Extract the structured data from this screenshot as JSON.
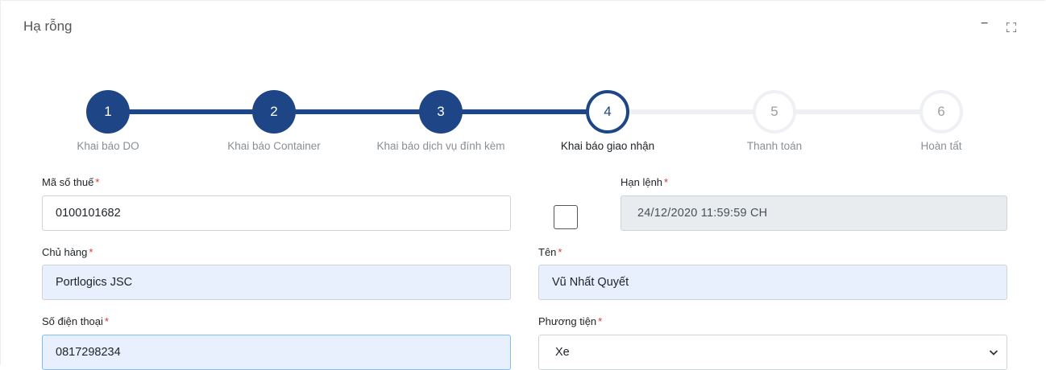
{
  "window": {
    "title": "Hạ rỗng",
    "minimize_label": "−"
  },
  "steps": [
    {
      "number": "1",
      "label": "Khai báo DO",
      "state": "done"
    },
    {
      "number": "2",
      "label": "Khai báo Container",
      "state": "done"
    },
    {
      "number": "3",
      "label": "Khai báo dịch vụ đính kèm",
      "state": "done"
    },
    {
      "number": "4",
      "label": "Khai báo giao nhận",
      "state": "current"
    },
    {
      "number": "5",
      "label": "Thanh toán",
      "state": "todo"
    },
    {
      "number": "6",
      "label": "Hoàn tất",
      "state": "todo"
    }
  ],
  "form": {
    "tax_code": {
      "label": "Mã số thuế",
      "required_mark": "*",
      "value": "0100101682"
    },
    "deadline": {
      "label": "Hạn lệnh",
      "required_mark": "*",
      "value": "24/12/2020 11:59:59 CH"
    },
    "owner": {
      "label": "Chủ hàng",
      "required_mark": "*",
      "value": "Portlogics JSC"
    },
    "name": {
      "label": "Tên",
      "required_mark": "*",
      "value": "Vũ Nhất Quyết"
    },
    "phone": {
      "label": "Số điện thoại",
      "required_mark": "*",
      "value": "0817298234"
    },
    "vehicle": {
      "label": "Phương tiện",
      "required_mark": "*",
      "value": "Xe"
    }
  },
  "colors": {
    "primary": "#1e4585",
    "required": "#e3342f",
    "autofill": "#e8f0fe",
    "disabled": "#e9ecef"
  }
}
